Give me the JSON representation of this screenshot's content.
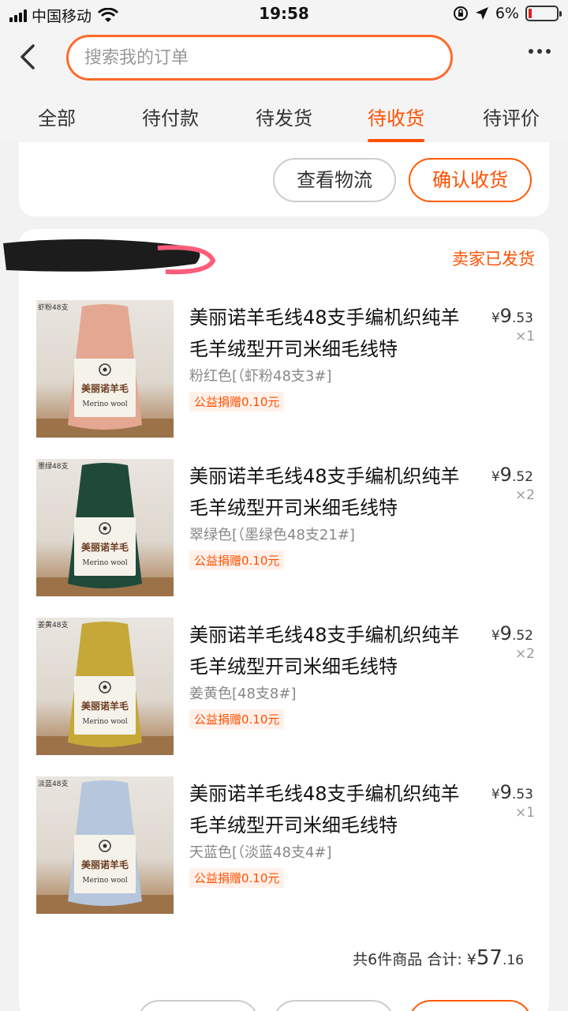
{
  "status_bar": {
    "carrier": "中国移动",
    "time": "19:58",
    "battery": "6%",
    "battery_level": 0.06
  },
  "header": {
    "search_placeholder": "搜索我的订单"
  },
  "tabs": [
    {
      "label": "全部",
      "active": false
    },
    {
      "label": "待付款",
      "active": false
    },
    {
      "label": "待发货",
      "active": false
    },
    {
      "label": "待收货",
      "active": true
    },
    {
      "label": "待评价",
      "active": false
    }
  ],
  "prev_order": {
    "logistics_label": "查看物流",
    "confirm_label": "确认收货"
  },
  "order": {
    "status": "卖家已发货",
    "items": [
      {
        "thumb_tag": "虾粉48支",
        "title": "美丽诺羊毛线48支手编机织纯羊毛羊绒型开司米细毛线特",
        "sku": "粉红色[（虾粉48支3#]",
        "charity": "公益捐赠0.10元",
        "price_symbol": "¥",
        "price_int": "9",
        "price_dec": ".53",
        "qty": "×1",
        "color": "#e4a892"
      },
      {
        "thumb_tag": "墨绿48支",
        "title": "美丽诺羊毛线48支手编机织纯羊毛羊绒型开司米细毛线特",
        "sku": "翠绿色[（墨绿色48支21#]",
        "charity": "公益捐赠0.10元",
        "price_symbol": "¥",
        "price_int": "9",
        "price_dec": ".52",
        "qty": "×2",
        "color": "#1f4a3a"
      },
      {
        "thumb_tag": "姜黄48支",
        "title": "美丽诺羊毛线48支手编机织纯羊毛羊绒型开司米细毛线特",
        "sku": "姜黄色[48支8#]",
        "charity": "公益捐赠0.10元",
        "price_symbol": "¥",
        "price_int": "9",
        "price_dec": ".52",
        "qty": "×2",
        "color": "#c5a838"
      },
      {
        "thumb_tag": "淡蓝48支",
        "title": "美丽诺羊毛线48支手编机织纯羊毛羊绒型开司米细毛线特",
        "sku": "天蓝色[（淡蓝48支4#]",
        "charity": "公益捐赠0.10元",
        "price_symbol": "¥",
        "price_int": "9",
        "price_dec": ".53",
        "qty": "×1",
        "color": "#b6c6dc"
      }
    ],
    "summary_count": "共6件商品",
    "summary_total_label": "合计:",
    "total_symbol": "¥",
    "total_int": "57",
    "total_dec": ".16",
    "label_logo_text": "美丽诺羊毛",
    "label_sub_text": "Merino wool"
  },
  "colors": {
    "accent": "#ff5000",
    "search_border": "#ff6a2a"
  }
}
